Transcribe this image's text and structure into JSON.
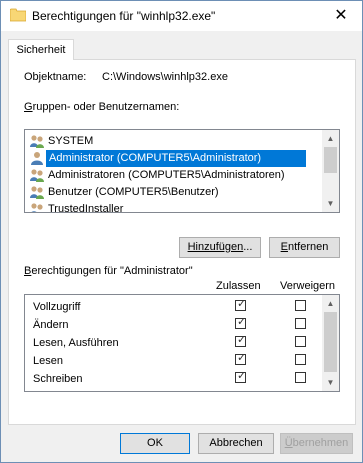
{
  "window": {
    "title": "Berechtigungen für \"winhlp32.exe\"",
    "close_glyph": "✕"
  },
  "tabs": [
    {
      "label": "Sicherheit"
    }
  ],
  "object": {
    "label": "Objektname:",
    "value": "C:\\Windows\\winhlp32.exe"
  },
  "groups": {
    "label_prefix": "G",
    "label_rest": "ruppen- oder Benutzernamen:",
    "items": [
      {
        "label": "SYSTEM",
        "icon": "users-icon"
      },
      {
        "label": "Administrator (COMPUTER5\\Administrator)",
        "icon": "user-icon",
        "selected": true
      },
      {
        "label": "Administratoren (COMPUTER5\\Administratoren)",
        "icon": "users-icon"
      },
      {
        "label": "Benutzer (COMPUTER5\\Benutzer)",
        "icon": "users-icon"
      },
      {
        "label": "TrustedInstaller",
        "icon": "users-icon"
      }
    ]
  },
  "buttons": {
    "add_prefix": "Hinzufügen",
    "add_suffix": "...",
    "remove_prefix": "E",
    "remove_rest": "ntfernen",
    "ok": "OK",
    "cancel": "Abbrechen",
    "apply_prefix": "Ü",
    "apply_rest": "bernehmen"
  },
  "permissions": {
    "label_prefix": "B",
    "label_rest": "erechtigungen für \"Administrator\"",
    "allow_header": "Zulassen",
    "deny_header": "Verweigern",
    "rows": [
      {
        "name": "Vollzugriff",
        "allow": true,
        "deny": false
      },
      {
        "name": "Ändern",
        "allow": true,
        "deny": false
      },
      {
        "name": "Lesen, Ausführen",
        "allow": true,
        "deny": false
      },
      {
        "name": "Lesen",
        "allow": true,
        "deny": false
      },
      {
        "name": "Schreiben",
        "allow": true,
        "deny": false
      }
    ]
  },
  "colors": {
    "selection": "#0078d7",
    "default_button_border": "#0078d7"
  }
}
